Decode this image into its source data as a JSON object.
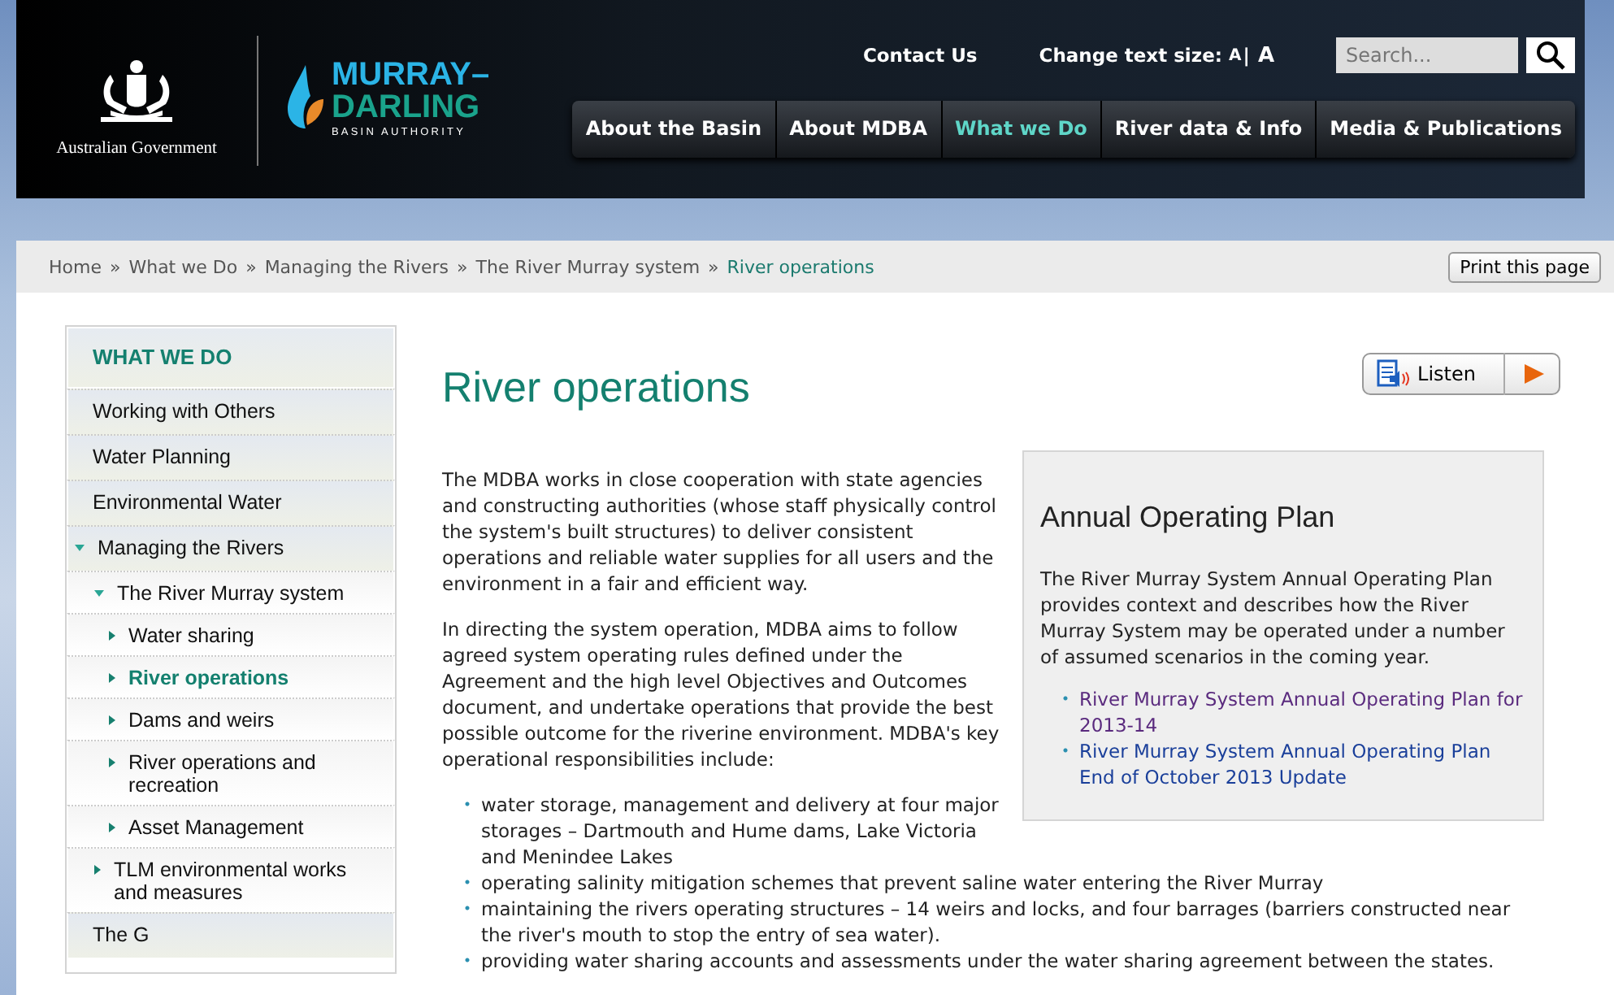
{
  "header": {
    "government": "Australian Government",
    "logo": {
      "line1": "MURRAY–",
      "line2": "DARLING",
      "line3": "BASIN AUTHORITY"
    },
    "top_links": [
      {
        "label": "Contact Us"
      }
    ],
    "text_size": {
      "label": "Change text size:",
      "options": [
        "A",
        "A"
      ],
      "separator": "|"
    },
    "search": {
      "placeholder": "Search..."
    },
    "nav": [
      {
        "label": "About the Basin",
        "selected": false
      },
      {
        "label": "About MDBA",
        "selected": false
      },
      {
        "label": "What we Do",
        "selected": true
      },
      {
        "label": "River data & Info",
        "selected": false
      },
      {
        "label": "Media & Publications",
        "selected": false
      }
    ]
  },
  "breadcrumb": {
    "separator": "»",
    "items": [
      {
        "label": "Home",
        "current": false
      },
      {
        "label": "What we Do",
        "current": false
      },
      {
        "label": "Managing the Rivers",
        "current": false
      },
      {
        "label": "The River Murray system",
        "current": false
      },
      {
        "label": "River operations",
        "current": true
      }
    ]
  },
  "print_button": "Print this page",
  "sidebar": {
    "title": "WHAT WE DO",
    "items": [
      {
        "label": "Working with Others",
        "selected": false
      },
      {
        "label": "Water Planning",
        "selected": false
      },
      {
        "label": "Environmental Water",
        "selected": false
      },
      {
        "label": "Managing the Rivers",
        "selected": false,
        "expanded": true,
        "children": [
          {
            "label": "The River Murray system",
            "selected": false,
            "expanded": true,
            "children": [
              {
                "label": "Water sharing",
                "selected": false,
                "expanded": false
              },
              {
                "label": "River operations",
                "selected": true,
                "expanded": false
              },
              {
                "label": "Dams and weirs",
                "selected": false,
                "expanded": false
              },
              {
                "label": "River operations and recreation",
                "selected": false,
                "expanded": false
              },
              {
                "label": "Asset Management",
                "selected": false,
                "expanded": false
              }
            ]
          },
          {
            "label": "TLM environmental works and measures",
            "selected": false,
            "expanded": false
          }
        ]
      },
      {
        "label": "The G",
        "selected": false
      }
    ]
  },
  "main": {
    "heading": "River operations",
    "listen": "Listen",
    "paragraphs": [
      "The MDBA works in close cooperation with state agencies and constructing authorities (whose staff physically control the system's built structures) to deliver consistent operations and reliable water supplies for all users and the environment in a fair and efficient way.",
      "In directing the system operation, MDBA aims to follow agreed system operating rules defined under the Agreement and the high level Objectives and Outcomes document, and undertake operations that provide the best possible outcome for the riverine environment. MDBA's key operational responsibilities include:"
    ],
    "bullets": [
      "water storage, management and delivery at four major storages – Dartmouth and Hume dams, Lake Victoria and Menindee Lakes",
      "operating salinity mitigation schemes that prevent saline water entering the River Murray",
      "maintaining the rivers operating structures – 14 weirs and locks, and four barrages (barriers constructed near the river's mouth to stop the entry of sea water).",
      "providing water sharing accounts and assessments under the water sharing agreement between the states."
    ],
    "aside": {
      "title": "Annual Operating Plan",
      "text": "The River Murray System Annual Operating Plan provides context and describes how the River Murray System may be operated under a number of assumed scenarios in the coming year.",
      "links": [
        {
          "label": "River Murray System Annual Operating Plan for 2013-14",
          "visited": true
        },
        {
          "label": "River Murray System Annual Operating Plan End of October 2013 Update",
          "visited": false
        }
      ]
    }
  }
}
